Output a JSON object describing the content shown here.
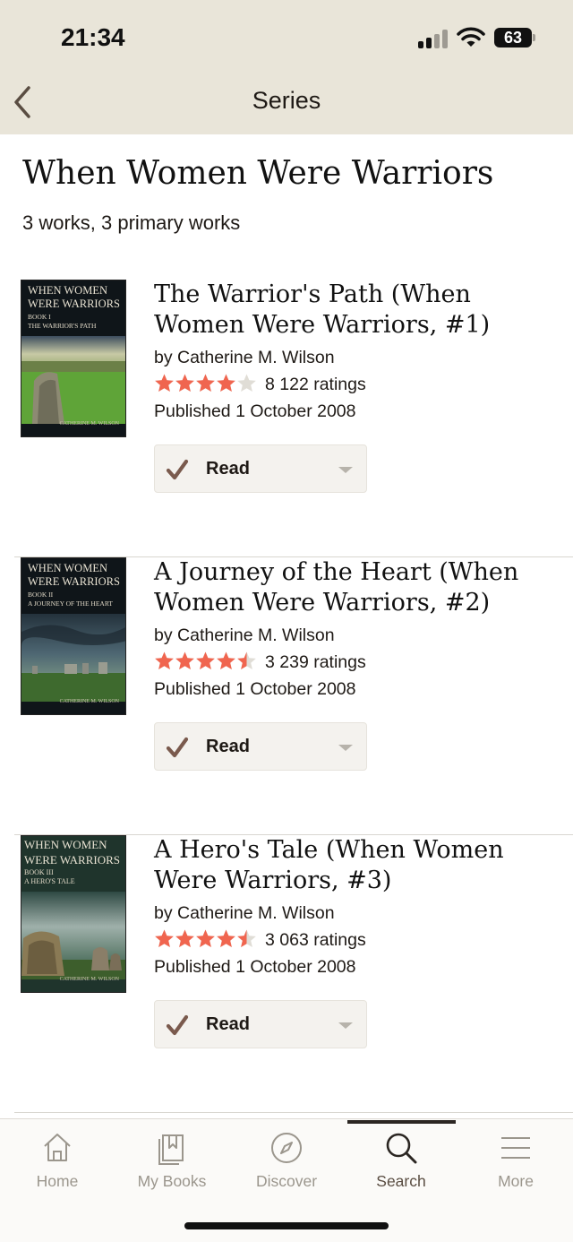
{
  "status_bar": {
    "time": "21:34",
    "battery": "63"
  },
  "nav": {
    "title": "Series"
  },
  "series": {
    "title": "When Women Were Warriors",
    "meta": "3 works, 3 primary works"
  },
  "books": [
    {
      "title": "The Warrior's Path (When Women Were Warriors, #1)",
      "author": "by Catherine M. Wilson",
      "rating": 4.0,
      "ratings": "8 122 ratings",
      "published": "Published 1 October 2008",
      "shelf": "Read",
      "cover": {
        "title_line1": "WHEN WOMEN",
        "title_line2": "WERE WARRIORS",
        "book_no": "BOOK I",
        "subtitle": "THE WARRIOR'S PATH",
        "author": "CATHERINE M. WILSON"
      }
    },
    {
      "title": "A Journey of the Heart (When Women Were Warriors, #2)",
      "author": "by Catherine M. Wilson",
      "rating": 4.5,
      "ratings": "3 239 ratings",
      "published": "Published 1 October 2008",
      "shelf": "Read",
      "cover": {
        "title_line1": "WHEN WOMEN",
        "title_line2": "WERE WARRIORS",
        "book_no": "BOOK II",
        "subtitle": "A JOURNEY OF THE HEART",
        "author": "CATHERINE M. WILSON"
      }
    },
    {
      "title": "A Hero's Tale (When Women Were Warriors,  #3)",
      "author": "by Catherine M. Wilson",
      "rating": 4.5,
      "ratings": "3 063 ratings",
      "published": "Published 1 October 2008",
      "shelf": "Read",
      "cover": {
        "title_line1": "WHEN WOMEN",
        "title_line2": "WERE WARRIORS",
        "book_no": "BOOK III",
        "subtitle": "A HERO'S TALE",
        "author": "CATHERINE M. WILSON"
      }
    }
  ],
  "tabs": [
    {
      "label": "Home",
      "icon": "home-icon",
      "active": false
    },
    {
      "label": "My Books",
      "icon": "my-books-icon",
      "active": false
    },
    {
      "label": "Discover",
      "icon": "compass-icon",
      "active": false
    },
    {
      "label": "Search",
      "icon": "search-icon",
      "active": true
    },
    {
      "label": "More",
      "icon": "menu-icon",
      "active": false
    }
  ],
  "colors": {
    "header_bg": "#e9e5d9",
    "star": "#f0654f",
    "star_empty": "#e0ddd6",
    "checkmark": "#7a5a4d",
    "active_tab": "#5a4d42"
  }
}
